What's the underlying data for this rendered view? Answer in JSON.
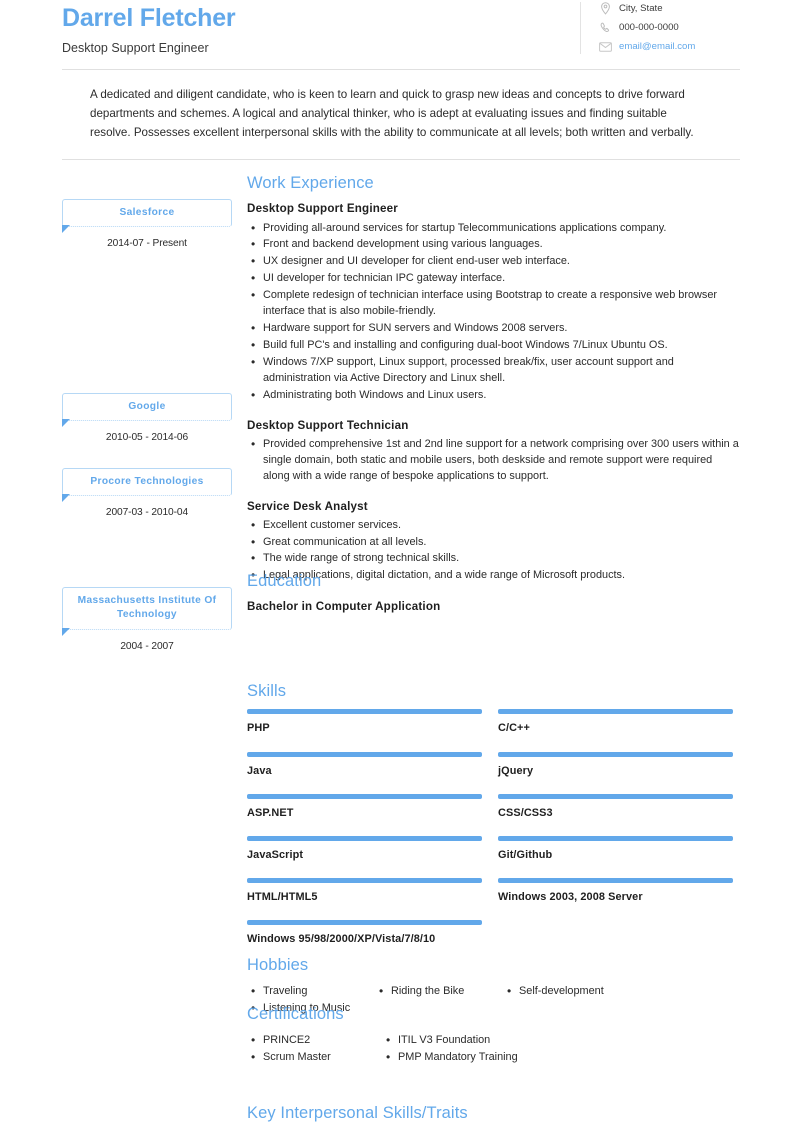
{
  "header": {
    "full_name": "Darrel Fletcher",
    "job_title": "Desktop Support Engineer",
    "contacts": [
      {
        "icon": "map-pin-icon",
        "text": "City, State",
        "is_link": false
      },
      {
        "icon": "phone-icon",
        "text": "000-000-0000",
        "is_link": false
      },
      {
        "icon": "envelope-icon",
        "text": "email@email.com",
        "is_link": true
      }
    ]
  },
  "summary": "A dedicated and diligent candidate, who is keen to learn and quick to grasp new ideas and concepts to drive forward departments and schemes. A logical and analytical thinker, who is adept at evaluating issues and finding suitable resolve. Possesses excellent interpersonal skills with the ability to communicate at all levels; both written and verbally.",
  "sections": {
    "work_experience": {
      "title": "Work Experience",
      "jobs": [
        {
          "role": "Desktop Support Engineer",
          "organization": "Salesforce",
          "dates": "2014-07 - Present",
          "bullets": [
            "Providing all-around services for startup Telecommunications applications company.",
            "Front and backend development using various languages.",
            "UX designer and UI developer for client end-user web interface.",
            "UI developer for technician IPC gateway interface.",
            "Complete redesign of technician interface using Bootstrap to create a responsive web browser interface that is also mobile-friendly.",
            "Hardware support for SUN servers and Windows 2008 servers.",
            "Build full PC's and installing and configuring dual-boot Windows 7/Linux Ubuntu OS.",
            "Windows 7/XP support, Linux support, processed break/fix, user account support and administration via Active Directory and Linux shell.",
            "Administrating both Windows and Linux users."
          ]
        },
        {
          "role": "Desktop Support Technician",
          "organization": "Google",
          "dates": "2010-05 - 2014-06",
          "bullets": [
            "Provided comprehensive 1st and 2nd line support for a network comprising over 300 users within a single domain, both static and mobile users, both deskside and remote support were required along with a wide range of bespoke applications to support."
          ]
        },
        {
          "role": "Service Desk Analyst",
          "organization": "Procore Technologies",
          "dates": "2007-03 - 2010-04",
          "bullets": [
            "Excellent customer services.",
            "Great communication at all levels.",
            "The wide range of strong technical skills.",
            "Legal applications, digital dictation, and a wide range of Microsoft products."
          ]
        }
      ]
    },
    "education": {
      "title": "Education",
      "entries": [
        {
          "degree": "Bachelor in Computer Application",
          "organization": "Massachusetts Institute Of Technology",
          "dates": "2004 - 2007"
        }
      ]
    },
    "skills": {
      "title": "Skills",
      "items": [
        "PHP",
        "C/C++",
        "Java",
        "jQuery",
        "ASP.NET",
        "CSS/CSS3",
        "JavaScript",
        "Git/Github",
        "HTML/HTML5",
        "Windows 2003, 2008 Server",
        "Windows 95/98/2000/XP/Vista/7/8/10"
      ]
    },
    "hobbies": {
      "title": "Hobbies",
      "items": [
        "Traveling",
        "Riding the Bike",
        "Self-development",
        "Listening to Music"
      ]
    },
    "certifications": {
      "title": "Certifications",
      "items": [
        "PRINCE2",
        "Scrum Master",
        "ITIL V3 Foundation",
        "PMP Mandatory Training"
      ]
    },
    "key_interpersonal": {
      "title": "Key Interpersonal Skills/Traits"
    }
  },
  "colors": {
    "accent_blue": "#62a8ea",
    "box_border": "#b6d8f5",
    "text": "#2b2b2b",
    "rule": "#e0e0e0"
  }
}
